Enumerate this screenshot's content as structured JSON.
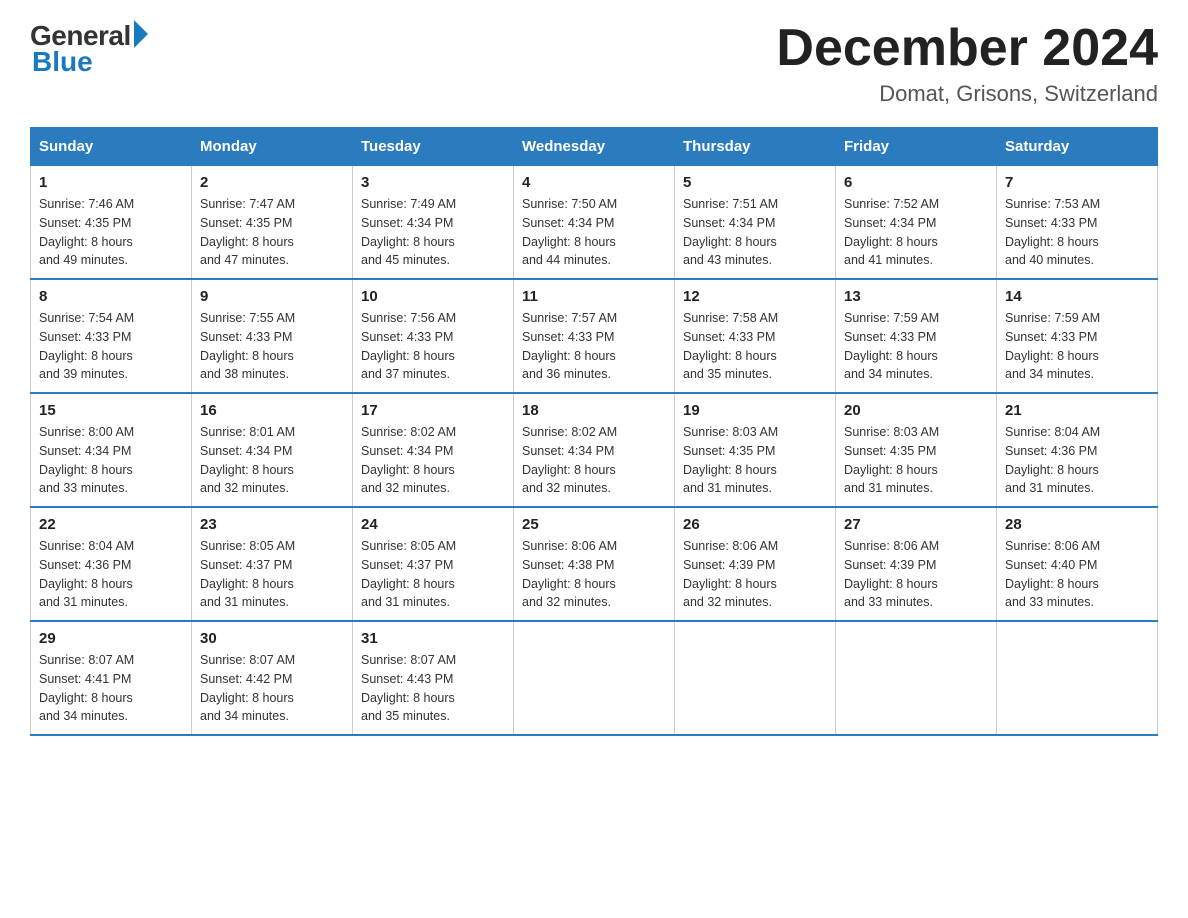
{
  "logo": {
    "general": "General",
    "blue": "Blue"
  },
  "title": "December 2024",
  "location": "Domat, Grisons, Switzerland",
  "days_of_week": [
    "Sunday",
    "Monday",
    "Tuesday",
    "Wednesday",
    "Thursday",
    "Friday",
    "Saturday"
  ],
  "weeks": [
    [
      {
        "day": "1",
        "sunrise": "7:46 AM",
        "sunset": "4:35 PM",
        "daylight": "8 hours and 49 minutes."
      },
      {
        "day": "2",
        "sunrise": "7:47 AM",
        "sunset": "4:35 PM",
        "daylight": "8 hours and 47 minutes."
      },
      {
        "day": "3",
        "sunrise": "7:49 AM",
        "sunset": "4:34 PM",
        "daylight": "8 hours and 45 minutes."
      },
      {
        "day": "4",
        "sunrise": "7:50 AM",
        "sunset": "4:34 PM",
        "daylight": "8 hours and 44 minutes."
      },
      {
        "day": "5",
        "sunrise": "7:51 AM",
        "sunset": "4:34 PM",
        "daylight": "8 hours and 43 minutes."
      },
      {
        "day": "6",
        "sunrise": "7:52 AM",
        "sunset": "4:34 PM",
        "daylight": "8 hours and 41 minutes."
      },
      {
        "day": "7",
        "sunrise": "7:53 AM",
        "sunset": "4:33 PM",
        "daylight": "8 hours and 40 minutes."
      }
    ],
    [
      {
        "day": "8",
        "sunrise": "7:54 AM",
        "sunset": "4:33 PM",
        "daylight": "8 hours and 39 minutes."
      },
      {
        "day": "9",
        "sunrise": "7:55 AM",
        "sunset": "4:33 PM",
        "daylight": "8 hours and 38 minutes."
      },
      {
        "day": "10",
        "sunrise": "7:56 AM",
        "sunset": "4:33 PM",
        "daylight": "8 hours and 37 minutes."
      },
      {
        "day": "11",
        "sunrise": "7:57 AM",
        "sunset": "4:33 PM",
        "daylight": "8 hours and 36 minutes."
      },
      {
        "day": "12",
        "sunrise": "7:58 AM",
        "sunset": "4:33 PM",
        "daylight": "8 hours and 35 minutes."
      },
      {
        "day": "13",
        "sunrise": "7:59 AM",
        "sunset": "4:33 PM",
        "daylight": "8 hours and 34 minutes."
      },
      {
        "day": "14",
        "sunrise": "7:59 AM",
        "sunset": "4:33 PM",
        "daylight": "8 hours and 34 minutes."
      }
    ],
    [
      {
        "day": "15",
        "sunrise": "8:00 AM",
        "sunset": "4:34 PM",
        "daylight": "8 hours and 33 minutes."
      },
      {
        "day": "16",
        "sunrise": "8:01 AM",
        "sunset": "4:34 PM",
        "daylight": "8 hours and 32 minutes."
      },
      {
        "day": "17",
        "sunrise": "8:02 AM",
        "sunset": "4:34 PM",
        "daylight": "8 hours and 32 minutes."
      },
      {
        "day": "18",
        "sunrise": "8:02 AM",
        "sunset": "4:34 PM",
        "daylight": "8 hours and 32 minutes."
      },
      {
        "day": "19",
        "sunrise": "8:03 AM",
        "sunset": "4:35 PM",
        "daylight": "8 hours and 31 minutes."
      },
      {
        "day": "20",
        "sunrise": "8:03 AM",
        "sunset": "4:35 PM",
        "daylight": "8 hours and 31 minutes."
      },
      {
        "day": "21",
        "sunrise": "8:04 AM",
        "sunset": "4:36 PM",
        "daylight": "8 hours and 31 minutes."
      }
    ],
    [
      {
        "day": "22",
        "sunrise": "8:04 AM",
        "sunset": "4:36 PM",
        "daylight": "8 hours and 31 minutes."
      },
      {
        "day": "23",
        "sunrise": "8:05 AM",
        "sunset": "4:37 PM",
        "daylight": "8 hours and 31 minutes."
      },
      {
        "day": "24",
        "sunrise": "8:05 AM",
        "sunset": "4:37 PM",
        "daylight": "8 hours and 31 minutes."
      },
      {
        "day": "25",
        "sunrise": "8:06 AM",
        "sunset": "4:38 PM",
        "daylight": "8 hours and 32 minutes."
      },
      {
        "day": "26",
        "sunrise": "8:06 AM",
        "sunset": "4:39 PM",
        "daylight": "8 hours and 32 minutes."
      },
      {
        "day": "27",
        "sunrise": "8:06 AM",
        "sunset": "4:39 PM",
        "daylight": "8 hours and 33 minutes."
      },
      {
        "day": "28",
        "sunrise": "8:06 AM",
        "sunset": "4:40 PM",
        "daylight": "8 hours and 33 minutes."
      }
    ],
    [
      {
        "day": "29",
        "sunrise": "8:07 AM",
        "sunset": "4:41 PM",
        "daylight": "8 hours and 34 minutes."
      },
      {
        "day": "30",
        "sunrise": "8:07 AM",
        "sunset": "4:42 PM",
        "daylight": "8 hours and 34 minutes."
      },
      {
        "day": "31",
        "sunrise": "8:07 AM",
        "sunset": "4:43 PM",
        "daylight": "8 hours and 35 minutes."
      },
      null,
      null,
      null,
      null
    ]
  ]
}
